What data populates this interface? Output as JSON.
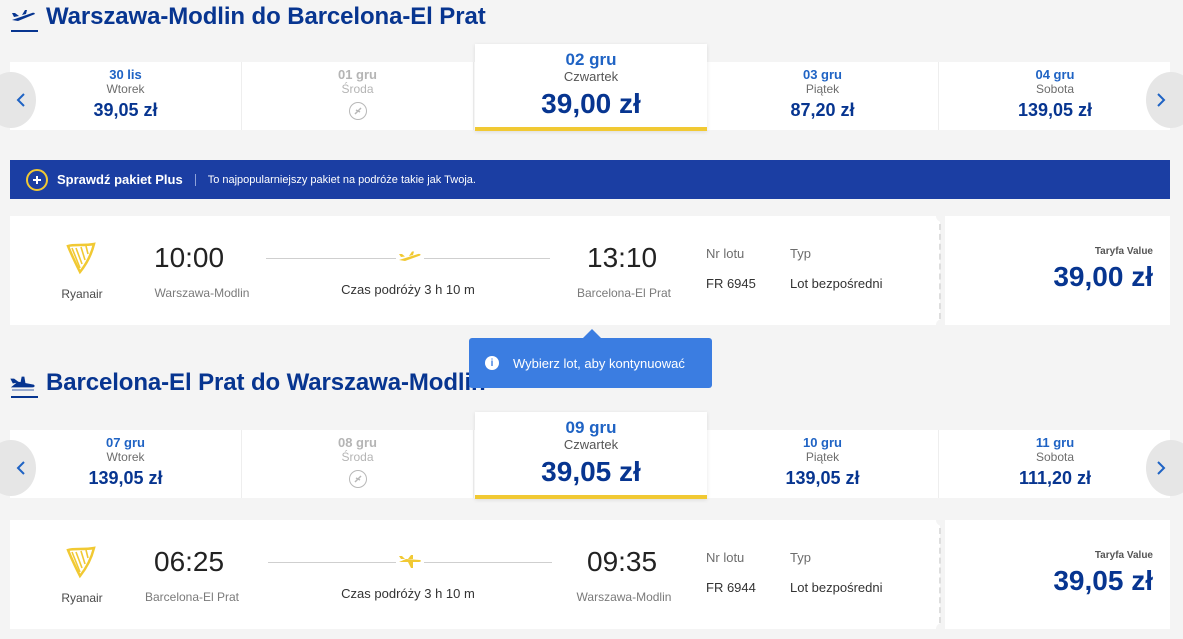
{
  "outbound": {
    "heading": "Warszawa-Modlin do Barcelona-El Prat",
    "days": [
      {
        "date": "30 lis",
        "dow": "Wtorek",
        "price": "39,05 zł",
        "state": "normal"
      },
      {
        "date": "01 gru",
        "dow": "Środa",
        "price": "",
        "state": "disabled"
      },
      {
        "date": "02 gru",
        "dow": "Czwartek",
        "price": "39,00 zł",
        "state": "selected"
      },
      {
        "date": "03 gru",
        "dow": "Piątek",
        "price": "87,20 zł",
        "state": "normal"
      },
      {
        "date": "04 gru",
        "dow": "Sobota",
        "price": "139,05 zł",
        "state": "normal"
      }
    ],
    "flight": {
      "airline": "Ryanair",
      "dep_time": "10:00",
      "dep_city": "Warszawa-Modlin",
      "duration": "Czas podróży 3 h 10 m",
      "arr_time": "13:10",
      "arr_city": "Barcelona-El Prat",
      "flight_no_label": "Nr lotu",
      "flight_no": "FR 6945",
      "type_label": "Typ",
      "type": "Lot bezpośredni",
      "fare_name": "Taryfa Value",
      "fare_price": "39,00 zł"
    }
  },
  "banner": {
    "title": "Sprawdź pakiet Plus",
    "description": "To najpopularniejszy pakiet na podróże takie jak Twoja."
  },
  "tooltip": {
    "message": "Wybierz lot, aby kontynuować"
  },
  "return": {
    "heading": "Barcelona-El Prat do Warszawa-Modlin",
    "days": [
      {
        "date": "07 gru",
        "dow": "Wtorek",
        "price": "139,05 zł",
        "state": "normal"
      },
      {
        "date": "08 gru",
        "dow": "Środa",
        "price": "",
        "state": "disabled"
      },
      {
        "date": "09 gru",
        "dow": "Czwartek",
        "price": "39,05 zł",
        "state": "selected"
      },
      {
        "date": "10 gru",
        "dow": "Piątek",
        "price": "139,05 zł",
        "state": "normal"
      },
      {
        "date": "11 gru",
        "dow": "Sobota",
        "price": "111,20 zł",
        "state": "normal"
      }
    ],
    "flight": {
      "airline": "Ryanair",
      "dep_time": "06:25",
      "dep_city": "Barcelona-El Prat",
      "duration": "Czas podróży 3 h 10 m",
      "arr_time": "09:35",
      "arr_city": "Warszawa-Modlin",
      "flight_no_label": "Nr lotu",
      "flight_no": "FR 6944",
      "type_label": "Typ",
      "type": "Lot bezpośredni",
      "fare_name": "Taryfa Value",
      "fare_price": "39,05 zł"
    }
  },
  "colors": {
    "brand_blue": "#073590",
    "accent_yellow": "#f1c933",
    "banner_blue": "#1b3ea3",
    "tooltip_blue": "#3b7de1"
  },
  "icons": {
    "heading_outbound": "plane-takeoff-icon",
    "heading_return": "plane-landing-icon",
    "carousel_prev": "chevron-left-icon",
    "carousel_next": "chevron-right-icon",
    "no_flight": "no-flight-icon",
    "banner": "plus-circle-icon",
    "airline_logo": "ryanair-harp-logo",
    "route": "plane-icon",
    "tooltip": "info-icon"
  }
}
